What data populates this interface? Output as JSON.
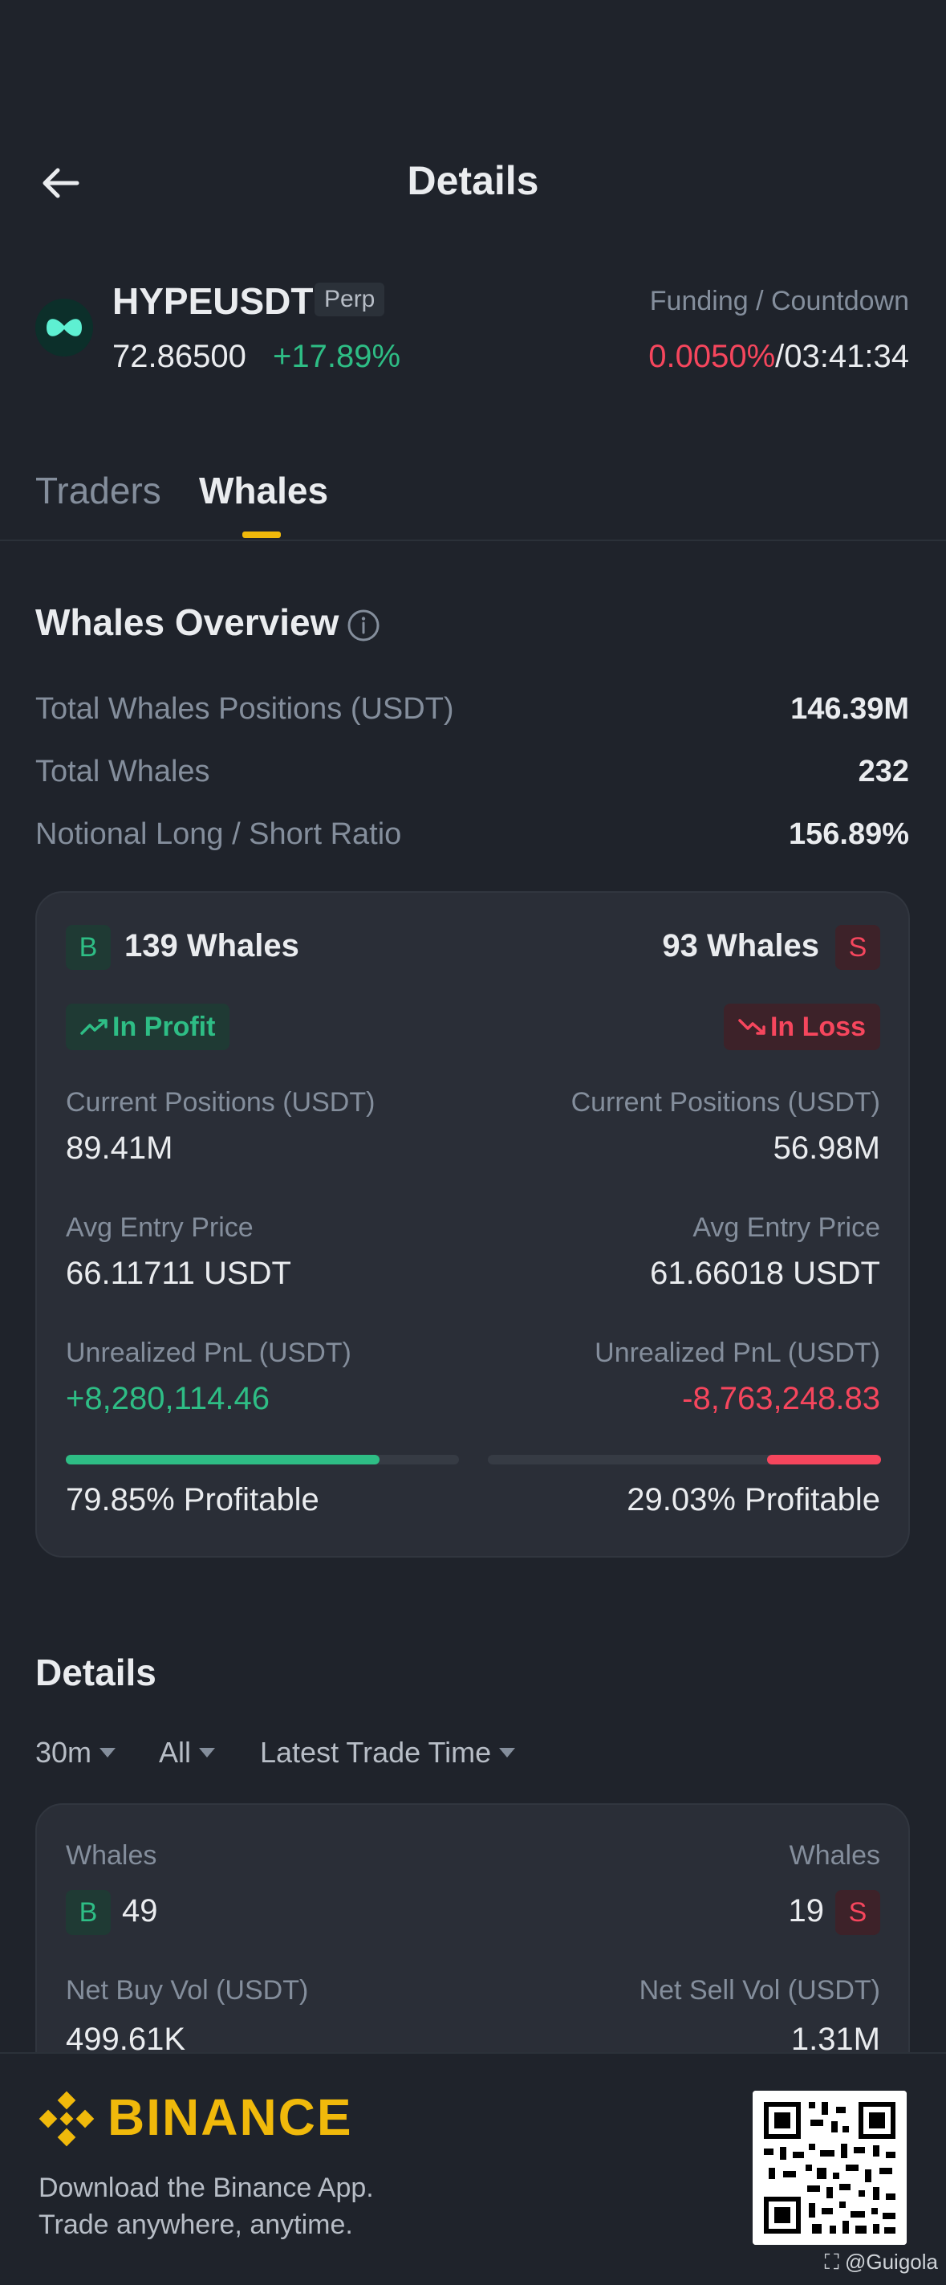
{
  "header": {
    "title": "Details"
  },
  "symbol": {
    "name": "HYPEUSDT",
    "type_badge": "Perp",
    "price": "72.86500",
    "change": "+17.89%",
    "funding_label": "Funding / Countdown",
    "funding_rate": "0.0050%",
    "funding_sep": "/",
    "countdown": "03:41:34"
  },
  "tabs": [
    {
      "label": "Traders",
      "active": false
    },
    {
      "label": "Whales",
      "active": true
    }
  ],
  "overview": {
    "title": "Whales Overview",
    "rows": [
      {
        "label": "Total Whales Positions (USDT)",
        "value": "146.39M"
      },
      {
        "label": "Total Whales",
        "value": "232"
      },
      {
        "label": "Notional Long / Short Ratio",
        "value": "156.89%"
      }
    ]
  },
  "summary": {
    "long": {
      "badge": "B",
      "count": "139 Whales",
      "status": "In Profit",
      "positions_label": "Current Positions (USDT)",
      "positions": "89.41M",
      "entry_label": "Avg Entry Price",
      "entry": "66.11711 USDT",
      "pnl_label": "Unrealized PnL (USDT)",
      "pnl": "+8,280,114.46",
      "profitable_pct": 79.85,
      "profitable": "79.85% Profitable"
    },
    "short": {
      "badge": "S",
      "count": "93 Whales",
      "status": "In Loss",
      "positions_label": "Current Positions (USDT)",
      "positions": "56.98M",
      "entry_label": "Avg Entry Price",
      "entry": "61.66018 USDT",
      "pnl_label": "Unrealized PnL (USDT)",
      "pnl": "-8,763,248.83",
      "profitable_pct": 29.03,
      "profitable": "29.03% Profitable"
    }
  },
  "details": {
    "title": "Details",
    "filters": [
      "30m",
      "All",
      "Latest Trade Time"
    ],
    "card": {
      "whales_label_left": "Whales",
      "whales_label_right": "Whales",
      "buy_badge": "B",
      "buy_whales": "49",
      "sell_badge": "S",
      "sell_whales": "19",
      "net_buy_label": "Net Buy Vol (USDT)",
      "net_buy": "499.61K",
      "net_sell_label": "Net Sell Vol (USDT)",
      "net_sell": "1.31M"
    }
  },
  "footer": {
    "brand": "BINANCE",
    "tagline1": "Download the Binance App.",
    "tagline2": "Trade anywhere, anytime.",
    "watermark": "@Guigola"
  },
  "colors": {
    "green": "#2ebd85",
    "red": "#f6465d",
    "brand": "#f0b90b"
  },
  "icons": [
    "back-arrow-icon",
    "hype-coin-icon",
    "info-icon",
    "trend-up-icon",
    "trend-down-icon",
    "caret-down-icon",
    "binance-logo-icon",
    "qr-code"
  ]
}
